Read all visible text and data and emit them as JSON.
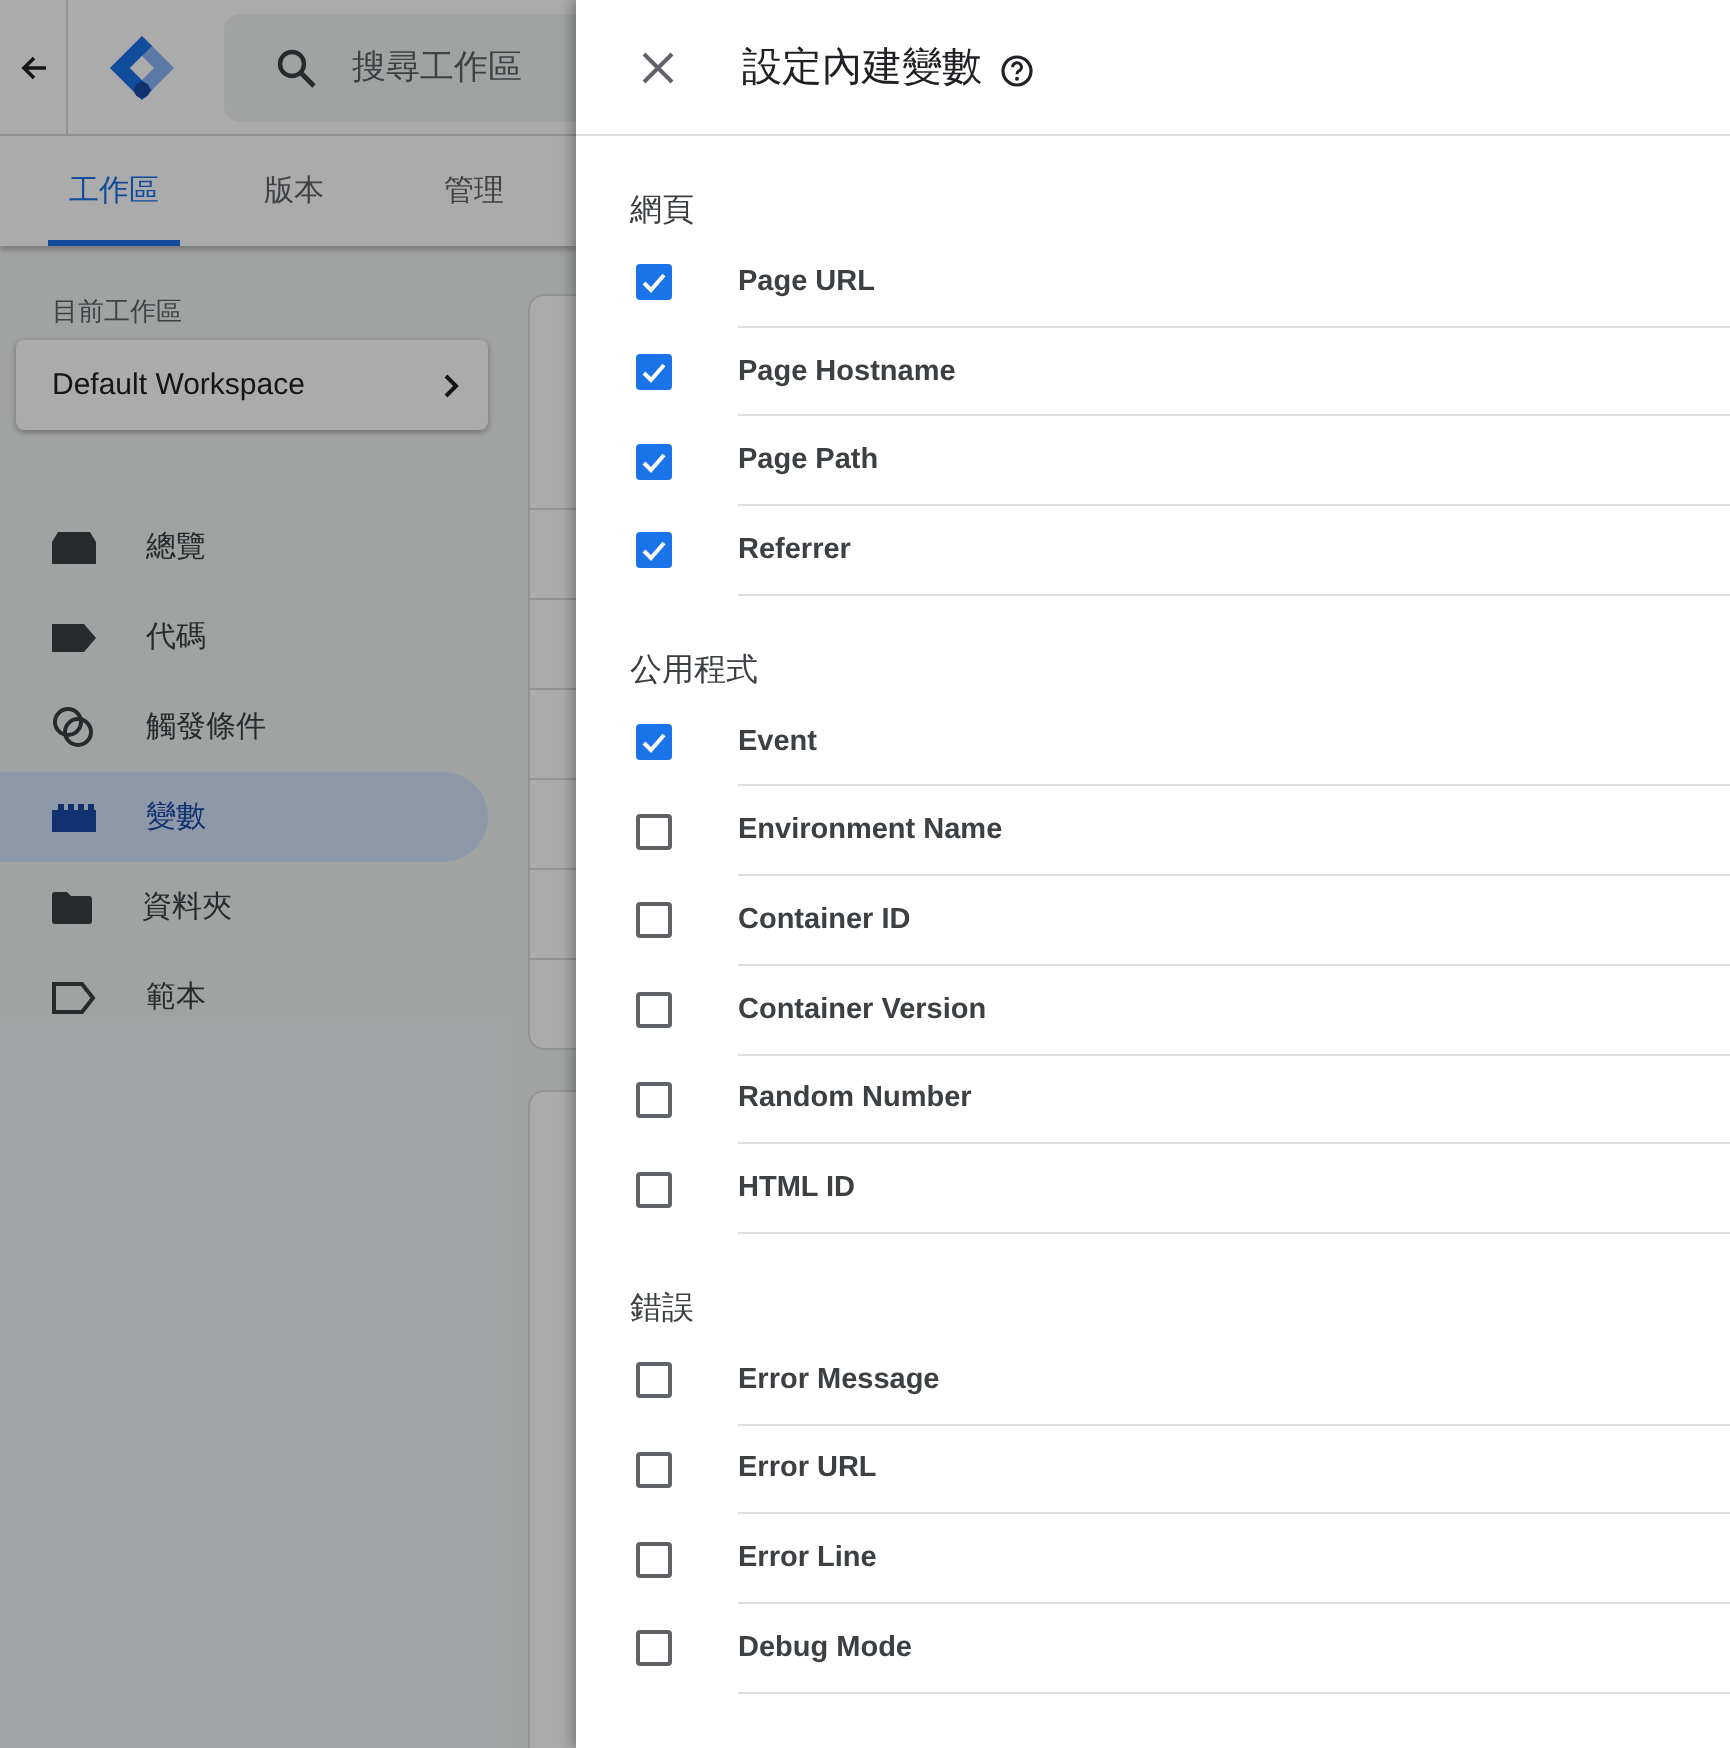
{
  "header": {
    "search": {
      "placeholder": "搜尋工作區"
    }
  },
  "tabs": [
    {
      "label": "工作區",
      "selected": true
    },
    {
      "label": "版本",
      "selected": false
    },
    {
      "label": "管理",
      "selected": false
    }
  ],
  "workspace": {
    "label": "目前工作區",
    "name": "Default Workspace"
  },
  "nav": [
    {
      "label": "總覽",
      "kind": "overview",
      "selected": false
    },
    {
      "label": "代碼",
      "kind": "tag",
      "selected": false
    },
    {
      "label": "觸發條件",
      "kind": "trigger",
      "selected": false
    },
    {
      "label": "變數",
      "kind": "variable",
      "selected": true
    },
    {
      "label": "資料夾",
      "kind": "folder",
      "selected": false
    },
    {
      "label": "範本",
      "kind": "template",
      "selected": false
    }
  ],
  "panel": {
    "title": "設定內建變數",
    "sections": [
      {
        "heading": "網頁",
        "items": [
          {
            "label": "Page URL",
            "checked": true
          },
          {
            "label": "Page Hostname",
            "checked": true
          },
          {
            "label": "Page Path",
            "checked": true
          },
          {
            "label": "Referrer",
            "checked": true
          }
        ]
      },
      {
        "heading": "公用程式",
        "items": [
          {
            "label": "Event",
            "checked": true
          },
          {
            "label": "Environment Name",
            "checked": false
          },
          {
            "label": "Container ID",
            "checked": false
          },
          {
            "label": "Container Version",
            "checked": false
          },
          {
            "label": "Random Number",
            "checked": false
          },
          {
            "label": "HTML ID",
            "checked": false
          }
        ]
      },
      {
        "heading": "錯誤",
        "items": [
          {
            "label": "Error Message",
            "checked": false
          },
          {
            "label": "Error URL",
            "checked": false
          },
          {
            "label": "Error Line",
            "checked": false
          },
          {
            "label": "Debug Mode",
            "checked": false
          }
        ]
      }
    ]
  }
}
